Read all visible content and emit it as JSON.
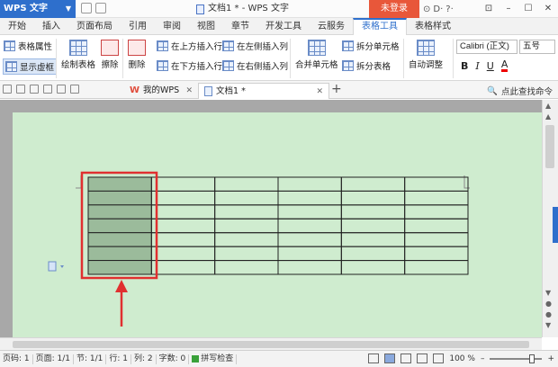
{
  "titlebar": {
    "app_name": "WPS 文字",
    "window_title": "文档1 * - WPS 文字",
    "login_label": "未登录",
    "right_icons": [
      "⊙",
      "D·",
      "?·"
    ],
    "window_controls": [
      "⊡",
      "–",
      "☐",
      "✕"
    ]
  },
  "tabs": [
    "开始",
    "插入",
    "页面布局",
    "引用",
    "审阅",
    "视图",
    "章节",
    "开发工具",
    "云服务",
    "表格工具",
    "表格样式"
  ],
  "active_tab": "表格工具",
  "ribbon": {
    "table_props": "表格属性",
    "show_gridlines": "显示虚框",
    "draw_table": "绘制表格",
    "erase": "擦除",
    "delete": "删除",
    "insert_above": "在上方插入行",
    "insert_below": "在下方插入行",
    "insert_left": "在左侧插入列",
    "insert_right": "在右侧插入列",
    "merge_cells": "合并单元格",
    "split_cells": "拆分单元格",
    "split_table": "拆分表格",
    "auto_fit": "自动调整",
    "font_name": "Calibri (正文)",
    "font_size": "五号",
    "fmt_bold": "B",
    "fmt_italic": "I",
    "fmt_underline": "U",
    "fmt_color": "A"
  },
  "doctabs": {
    "tab1": "我的WPS",
    "tab2": "文档1 *",
    "new_tab": "+",
    "search": "点此查找命令"
  },
  "table": {
    "rows": 7,
    "cols": 6,
    "selected_col": 0
  },
  "status": {
    "page_num": "页码: 1",
    "pages": "页面: 1/1",
    "section": "节: 1/1",
    "row": "行: 1",
    "col": "列: 2",
    "words": "字数: 0",
    "spell": "拼写检查",
    "zoom": "100 %"
  },
  "colors": {
    "accent": "#2e6fcc",
    "page_bg": "#cfeccf",
    "selected_col": "#9bbb9b",
    "highlight": "#e03030"
  }
}
